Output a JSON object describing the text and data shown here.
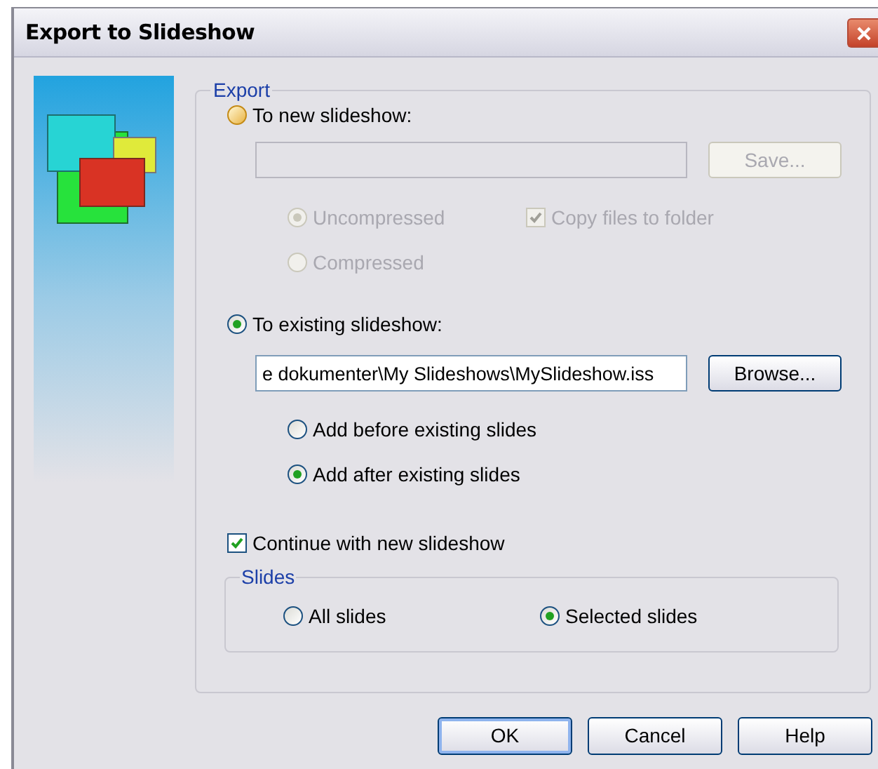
{
  "window": {
    "title": "Export to Slideshow"
  },
  "export_group": {
    "label": "Export",
    "to_new": {
      "label": "To new slideshow:",
      "selected": false,
      "highlighted": true
    },
    "new_path_field": {
      "disabled": true
    },
    "save_button": {
      "label": "Save...",
      "disabled": true
    },
    "formats": [
      {
        "label": "Uncompressed",
        "selected": true,
        "disabled": true
      },
      {
        "label": "Compressed",
        "selected": false,
        "disabled": true
      }
    ],
    "copy_files": {
      "label": "Copy files to folder",
      "checked": true,
      "disabled": true
    },
    "to_existing": {
      "label": "To existing slideshow:",
      "selected": true,
      "highlighted": false
    },
    "existing_path_field": {
      "value": "e dokumenter\\My Slideshows\\MySlideshow.iss"
    },
    "browse_button": {
      "label": "Browse...",
      "disabled": false
    },
    "placement": [
      {
        "label": "Add before existing slides",
        "selected": false,
        "disabled": false
      },
      {
        "label": "Add after existing slides",
        "selected": true,
        "disabled": false
      }
    ],
    "continue_new": {
      "label": "Continue with new slideshow",
      "checked": true,
      "disabled": false
    },
    "slides_group": {
      "label": "Slides",
      "options": [
        {
          "label": "All slides",
          "selected": false,
          "disabled": false
        },
        {
          "label": "Selected slides",
          "selected": true,
          "disabled": false
        }
      ]
    }
  },
  "buttons": [
    {
      "label": "OK",
      "default": true
    },
    {
      "label": "Cancel",
      "default": false
    },
    {
      "label": "Help",
      "default": false
    }
  ]
}
